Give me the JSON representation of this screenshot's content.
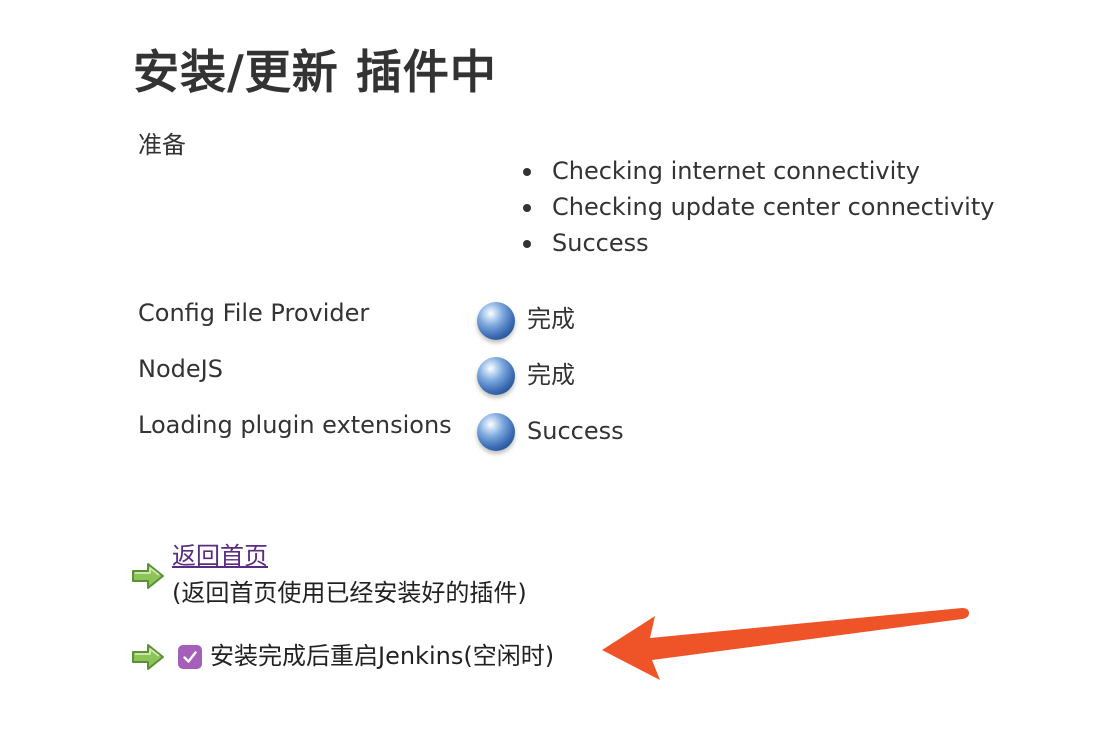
{
  "page": {
    "title": "安装/更新 插件中"
  },
  "preparation": {
    "label": "准备",
    "checks": [
      "Checking internet connectivity",
      "Checking update center connectivity",
      "Success"
    ]
  },
  "plugins": [
    {
      "name": "Config File Provider",
      "status": "完成",
      "icon": "blue-ball-icon"
    },
    {
      "name": "NodeJS",
      "status": "完成",
      "icon": "blue-ball-icon"
    },
    {
      "name": "Loading plugin extensions",
      "status": "Success",
      "icon": "blue-ball-icon"
    }
  ],
  "actions": {
    "home_link": "返回首页",
    "home_note": "(返回首页使用已经安装好的插件)",
    "restart_label": "安装完成后重启Jenkins(空闲时)",
    "restart_checked": true
  },
  "colors": {
    "link": "#5a2d82",
    "checkbox": "#a55fb8",
    "annotation_arrow": "#ee5427",
    "next_arrow": "#7ab648"
  }
}
